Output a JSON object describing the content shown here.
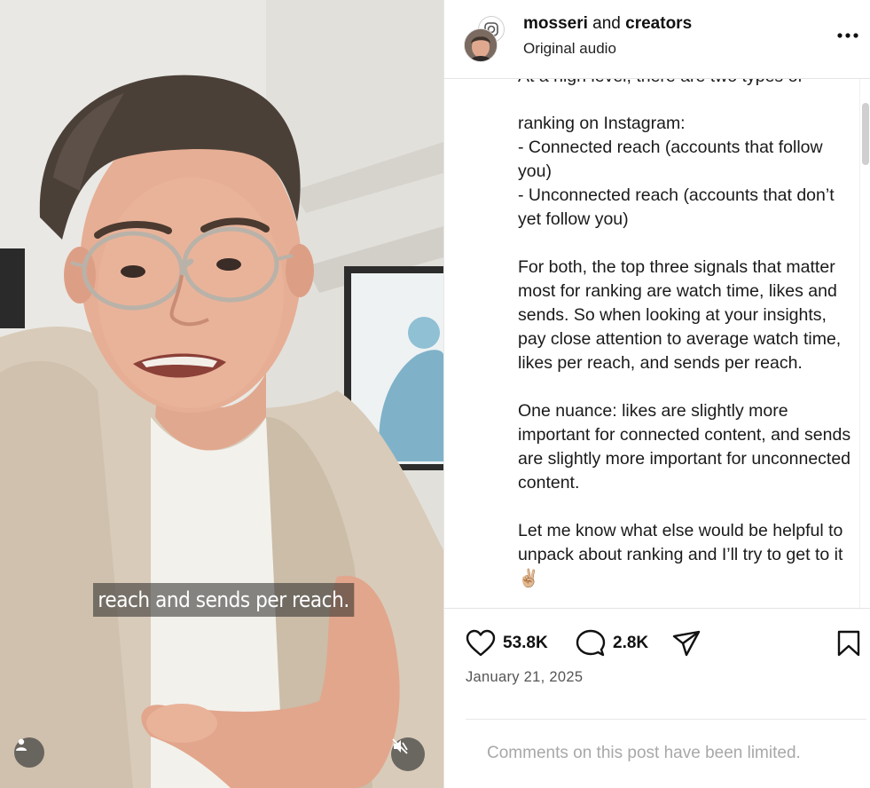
{
  "video": {
    "subtitle": "reach and sends per reach.",
    "icons": {
      "user_tag": "person-icon",
      "mute": "speaker-muted-icon"
    }
  },
  "post": {
    "header": {
      "username": "mosseri",
      "and_text": " and ",
      "collaborator": "creators",
      "audio": "Original audio",
      "more_icon": "more-horizontal-icon"
    },
    "caption": {
      "partial_line": "At a high level, there are two types of",
      "body": "ranking on Instagram:\n- Connected reach (accounts that follow you)\n- Unconnected reach (accounts that don’t yet follow you)\n\nFor both, the top three signals that matter most for ranking are watch time, likes and sends. So when looking at your insights, pay close attention to average watch time, likes per reach, and sends per reach.\n\nOne nuance: likes are slightly more important for connected content, and sends are slightly more important for unconnected content.\n\nLet me know what else would be helpful to unpack about ranking and I’ll try to get to it ✌🏼"
    },
    "actions": {
      "likes": "53.8K",
      "comments": "2.8K",
      "icons": [
        "heart-icon",
        "comment-icon",
        "share-icon",
        "bookmark-icon"
      ]
    },
    "date": "January 21, 2025",
    "comments_limited": "Comments on this post have been limited."
  },
  "colors": {
    "text_primary": "#111111",
    "text_secondary": "#555555",
    "text_muted": "#a8a8a8",
    "divider": "#e4e4e4"
  }
}
